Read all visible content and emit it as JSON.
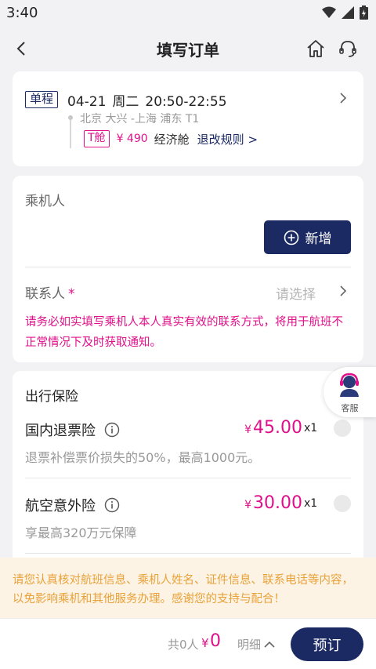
{
  "status_bar": {
    "time": "3:40",
    "icons": [
      "wifi-icon",
      "signal-icon",
      "battery-icon"
    ]
  },
  "nav": {
    "title": "填写订单",
    "icons": [
      "back-arrow-icon",
      "home-icon",
      "headset-icon"
    ]
  },
  "flight": {
    "trip_type": "单程",
    "date": "04-21",
    "weekday": "周二",
    "time": "20:50-22:55",
    "route": "北京 大兴 -上海 浦东 T1",
    "cabin_code": "T舱",
    "price": "¥ 490",
    "cabin_class": "经济舱",
    "rules_link": "退改规则 >"
  },
  "passenger": {
    "section_label": "乘机人",
    "add_button": "新增",
    "contact_label": "联系人",
    "required_mark": "*",
    "contact_placeholder": "请选择",
    "contact_note": "请务必如实填写乘机人本人真实有效的联系方式，将用于航班不正常情况下及时获取通知。"
  },
  "insurance": {
    "title": "出行保险",
    "items": [
      {
        "name": "国内退票险",
        "currency": "¥",
        "amount": "45.00",
        "qty": "x1",
        "desc": "退票补偿票价损失的50%，最高1000元。"
      },
      {
        "name": "航空意外险",
        "currency": "¥",
        "amount": "30.00",
        "qty": "x1",
        "desc": "享最高320万元保障"
      }
    ]
  },
  "customer_service": {
    "label": "客服"
  },
  "notice": "请您认真核对航班信息、乘机人姓名、证件信息、联系电话等内容，以免影响乘机和其他服务办理。感谢您的支持与配合！",
  "footer": {
    "count_label": "共0人",
    "currency": "¥",
    "total": "0",
    "detail_label": "明细",
    "book_button": "预订"
  },
  "colors": {
    "brand_navy": "#1b2a63",
    "accent_magenta": "#e0108a",
    "notice_orange": "#e8a23a",
    "notice_bg": "#fdf3e4"
  }
}
